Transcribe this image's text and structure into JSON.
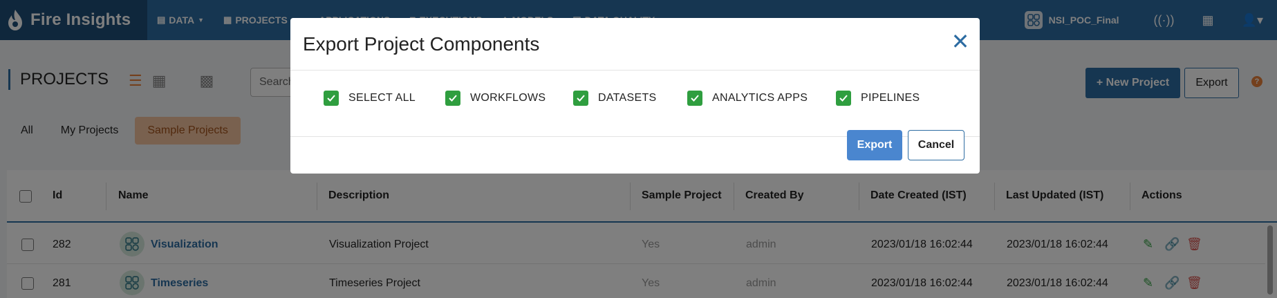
{
  "brand": {
    "name": "Fire Insights"
  },
  "nav": {
    "items": [
      {
        "label": "DATA",
        "icon": "file-icon",
        "caret": true
      },
      {
        "label": "PROJECTS",
        "icon": "grid-icon",
        "caret": false
      },
      {
        "label": "APPLICATIONS",
        "icon": "app-icon",
        "caret": false
      },
      {
        "label": "EXECUTIONS",
        "icon": "execution-icon",
        "caret": false
      },
      {
        "label": "MODELS",
        "icon": "model-icon",
        "caret": false
      },
      {
        "label": "DATA QUALITY",
        "icon": "quality-icon",
        "caret": false
      }
    ],
    "workspace": "NSI_POC_Final"
  },
  "page": {
    "title": "PROJECTS",
    "search_placeholder": "Search",
    "new_project_label": "+ New Project",
    "export_label": "Export",
    "help": "?"
  },
  "filters": [
    "All",
    "My Projects",
    "Sample Projects"
  ],
  "table": {
    "headers": [
      "Id",
      "Name",
      "Description",
      "Sample Project",
      "Created By",
      "Date Created (IST)",
      "Last Updated (IST)",
      "Actions"
    ],
    "rows": [
      {
        "id": "282",
        "name": "Visualization",
        "description": "Visualization Project",
        "sample": "Yes",
        "created_by": "admin",
        "date_created": "2023/01/18 16:02:44",
        "last_updated": "2023/01/18 16:02:44"
      },
      {
        "id": "281",
        "name": "Timeseries",
        "description": "Timeseries Project",
        "sample": "Yes",
        "created_by": "admin",
        "date_created": "2023/01/18 16:02:44",
        "last_updated": "2023/01/18 16:02:44"
      }
    ]
  },
  "modal": {
    "title": "Export Project Components",
    "options": [
      "SELECT ALL",
      "WORKFLOWS",
      "DATASETS",
      "ANALYTICS APPS",
      "PIPELINES"
    ],
    "export_label": "Export",
    "cancel_label": "Cancel"
  },
  "colors": {
    "primary": "#2d6ca2",
    "accent": "#e8813a",
    "check": "#2f9e3f"
  }
}
